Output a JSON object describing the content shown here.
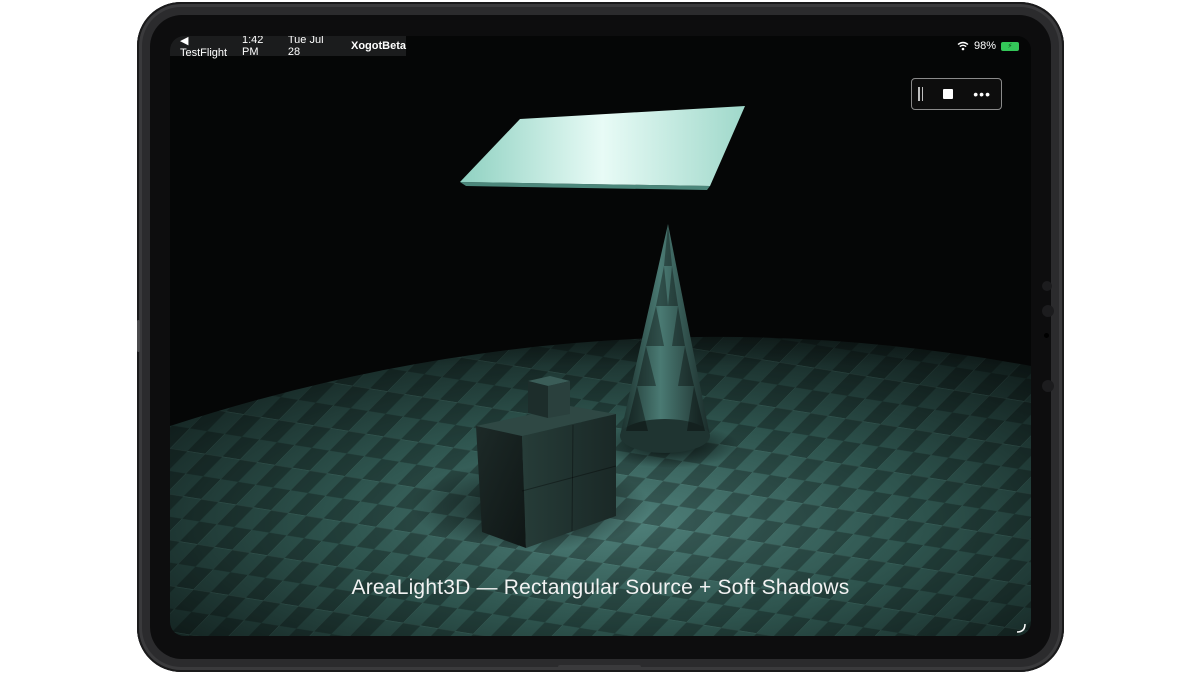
{
  "status_bar": {
    "back_app": "◀ TestFlight",
    "time": "1:42 PM",
    "date": "Tue Jul 28",
    "app_name": "XogotBeta",
    "battery": "98%"
  },
  "caption": "AreaLight3D — Rectangular Source + Soft Shadows",
  "colors": {
    "floor_light": "#3c6760",
    "floor_dark": "#1e3834",
    "light_panel": "#c8f2e8",
    "battery_green": "#34c759"
  },
  "icons": {
    "toolbar": [
      "grip-icon",
      "stop-icon",
      "more-icon"
    ],
    "status": [
      "wifi-icon",
      "battery-icon"
    ]
  }
}
